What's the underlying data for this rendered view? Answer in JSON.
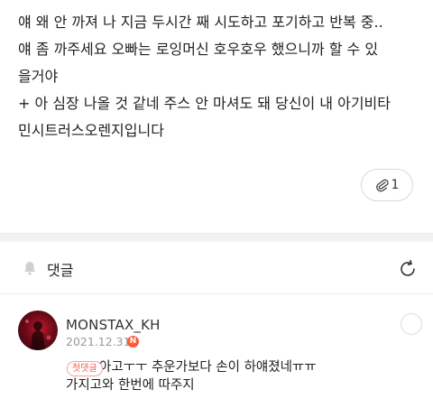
{
  "post": {
    "lines": [
      "얘 왜 안 까져 나 지금 두시간 째 시도하고 포기하고 반복 중..",
      "얘 좀 까주세요 오빠는 로잉머신 호우호우 했으니까 할 수 있",
      "을거야",
      "+ 아 심장 나올 것 같네 주스 안 마셔도 돼 당신이 내 아기비타",
      "민시트러스오렌지입니다"
    ]
  },
  "attachment": {
    "icon": "paperclip-icon",
    "count": "1"
  },
  "comments_section": {
    "title": "댓글",
    "bell_icon": "bell-icon",
    "refresh_icon": "refresh-icon"
  },
  "comment": {
    "username": "MONSTAX_KH",
    "date": "2021.12.31",
    "new_badge": "N",
    "first_tag": "첫댓글",
    "text_line1": "아고ㅜㅜ 추운가보다 손이 하얘졌네ㅠㅠ",
    "text_line2": "가지고와 한번에 따주지",
    "colors": {
      "new_badge": "#ff5a36",
      "first_tag": "#ef5b4f"
    }
  }
}
